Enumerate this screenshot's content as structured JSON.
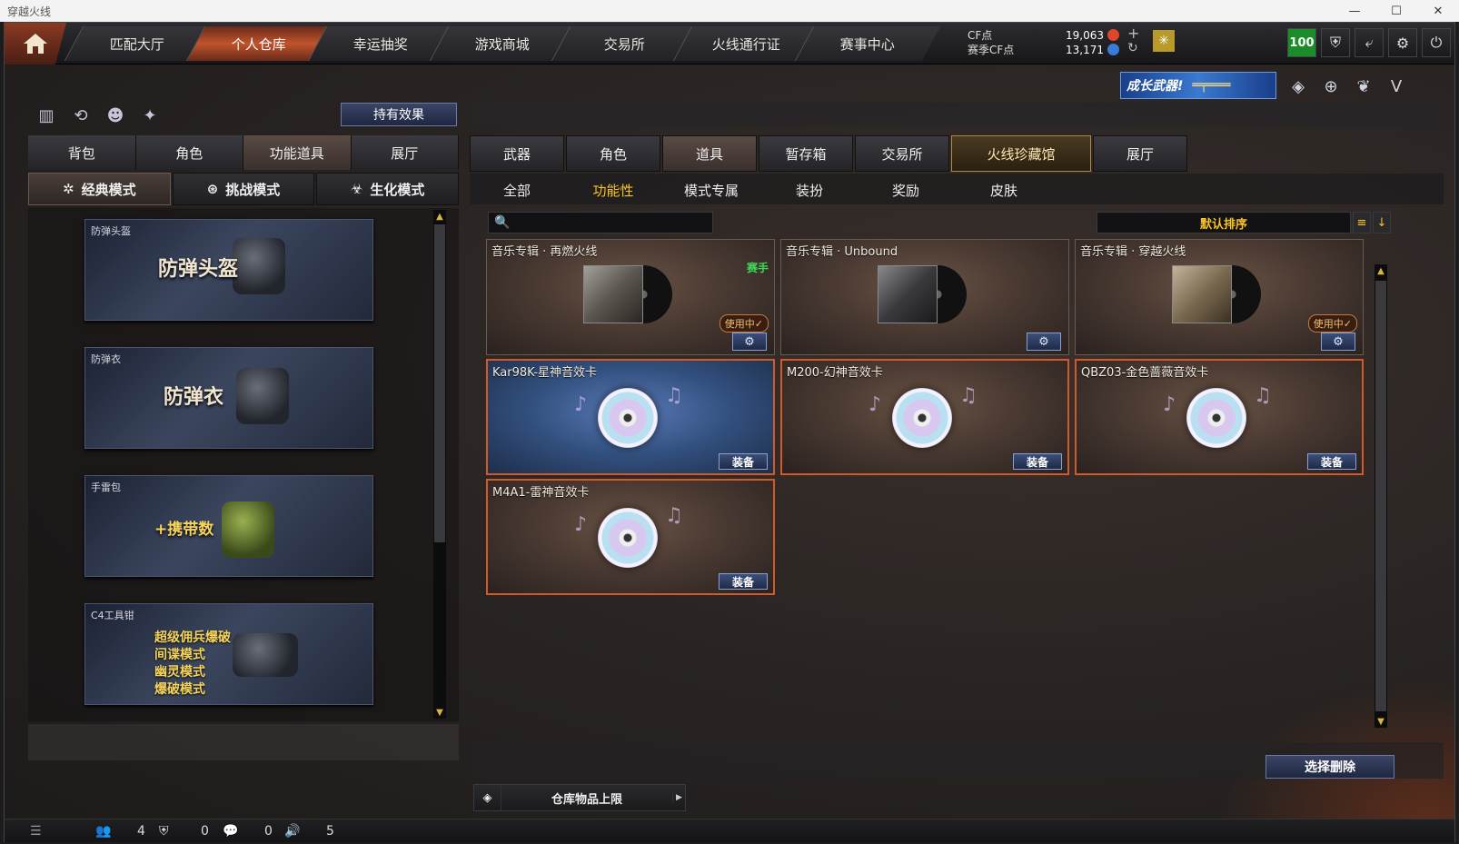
{
  "window": {
    "title": "穿越火线",
    "controls": [
      "—",
      "☐",
      "✕"
    ]
  },
  "nav": {
    "tabs": [
      "匹配大厅",
      "个人仓库",
      "幸运抽奖",
      "游戏商城",
      "交易所",
      "火线通行证",
      "赛事中心"
    ],
    "active_index": 1
  },
  "currency": {
    "cf_label": "CF点",
    "season_label": "赛季CF点",
    "cf_value": "19,063",
    "season_value": "13,171"
  },
  "top_icons": {
    "level": "100",
    "icons": [
      "shield-icon",
      "return-icon",
      "gear-icon",
      "power-icon"
    ]
  },
  "growth_banner": "成长武器!",
  "left": {
    "effect_button": "持有效果",
    "tabs": [
      "背包",
      "角色",
      "功能道具",
      "展厅"
    ],
    "active_tab": 2,
    "modes": [
      "经典模式",
      "挑战模式",
      "生化模式"
    ],
    "active_mode": 0,
    "items": [
      {
        "caption": "防弹头盔",
        "art": "防弹头盔"
      },
      {
        "caption": "防弹衣",
        "art": "防弹衣"
      },
      {
        "caption": "手雷包",
        "art": "+携带数"
      },
      {
        "caption": "C4工具钳",
        "art_lines": [
          "超级佣兵爆破",
          "间谍模式",
          "幽灵模式",
          "爆破模式"
        ]
      }
    ]
  },
  "right": {
    "tabs": [
      "武器",
      "角色",
      "道具",
      "暂存箱",
      "交易所",
      "火线珍藏馆",
      "展厅"
    ],
    "selected_tab": 2,
    "highlight_tab": 5,
    "subtabs": [
      "全部",
      "功能性",
      "模式专属",
      "装扮",
      "奖励",
      "皮肤"
    ],
    "active_subtab": 1,
    "search_placeholder": "",
    "sort_label": "默认排序",
    "cards": [
      {
        "title": "音乐专辑 · 再燃火线",
        "tag": "赛手",
        "in_use": "使用中✓",
        "type": "album"
      },
      {
        "title": "音乐专辑 · Unbound",
        "type": "album"
      },
      {
        "title": "音乐专辑 · 穿越火线",
        "in_use": "使用中✓",
        "type": "album"
      },
      {
        "title": "Kar98K-星神音效卡",
        "equip": "装备",
        "type": "cd"
      },
      {
        "title": "M200-幻神音效卡",
        "equip": "装备",
        "type": "cd"
      },
      {
        "title": "QBZ03-金色蔷薇音效卡",
        "equip": "装备",
        "type": "cd"
      },
      {
        "title": "M4A1-雷神音效卡",
        "equip": "装备",
        "type": "cd"
      }
    ],
    "delete_button": "选择删除",
    "storage_label": "仓库物品上限"
  },
  "status": {
    "shield_count": "4",
    "chat_count": "0",
    "volume_count": "0",
    "extra": "5"
  }
}
